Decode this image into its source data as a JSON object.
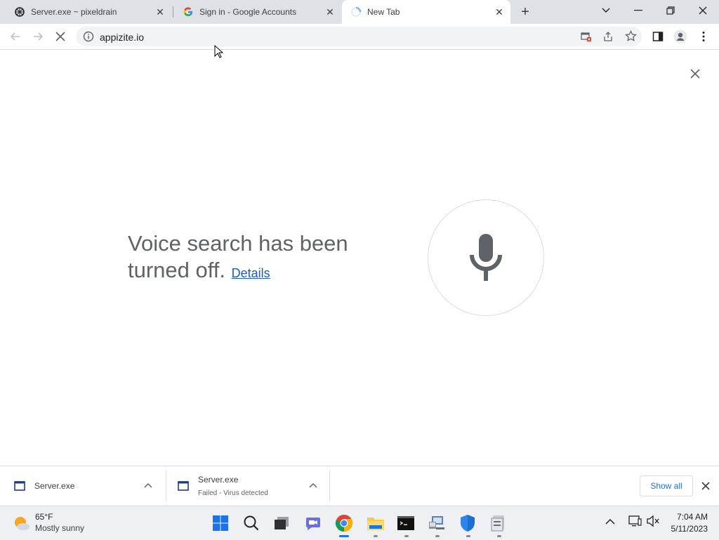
{
  "tabs": [
    {
      "title": "Server.exe ~ pixeldrain",
      "icon": "pixeldrain-icon"
    },
    {
      "title": "Sign in - Google Accounts",
      "icon": "google-icon"
    },
    {
      "title": "New Tab",
      "icon": "loading-spinner-icon"
    }
  ],
  "omnibox": {
    "url": "appizite.io"
  },
  "voice": {
    "message": "Voice search has been turned off.",
    "details_link": "Details"
  },
  "downloads": [
    {
      "filename": "Server.exe",
      "status": ""
    },
    {
      "filename": "Server.exe",
      "status": "Failed - Virus detected"
    }
  ],
  "download_bar": {
    "show_all": "Show all"
  },
  "taskbar": {
    "weather_temp": "65°F",
    "weather_desc": "Mostly sunny",
    "time": "7:04 AM",
    "date": "5/11/2023"
  },
  "colors": {
    "accent": "#1a73e8",
    "link": "#1a5fb4",
    "mic": "#5f6368"
  }
}
